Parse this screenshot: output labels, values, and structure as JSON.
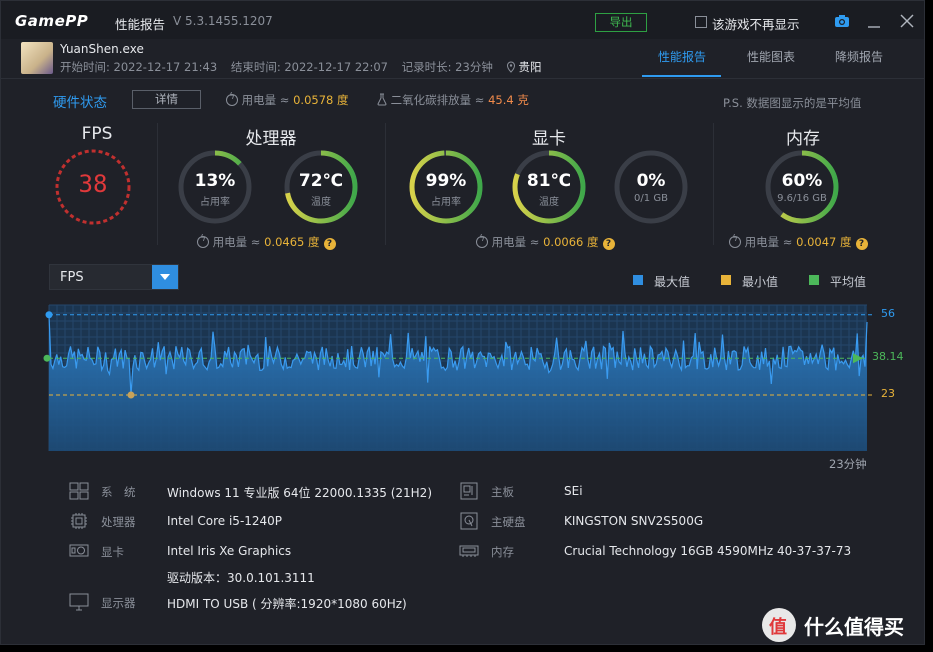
{
  "titlebar": {
    "logo": "GamePP",
    "title": "性能报告",
    "version": "V 5.3.1455.1207",
    "export_label": "导出",
    "no_show_label": "该游戏不再显示"
  },
  "process": {
    "name": "YuanShen.exe",
    "start_time": "开始时间: 2022-12-17 21:43",
    "end_time": "结束时间: 2022-12-17 22:07",
    "duration": "记录时长: 23分钟",
    "location": "贵阳"
  },
  "tabs": [
    {
      "label": "性能报告",
      "active": true
    },
    {
      "label": "性能图表",
      "active": false
    },
    {
      "label": "降频报告",
      "active": false
    }
  ],
  "hardware": {
    "title": "硬件状态",
    "detail_btn": "详情",
    "power_label": "用电量 ≈",
    "power_value": "0.0578 度",
    "co2_label": "二氧化碳排放量 ≈",
    "co2_value": "45.4 克",
    "note": "P.S. 数据图显示的是平均值"
  },
  "sections": {
    "fps": {
      "title": "FPS",
      "value": "38"
    },
    "cpu": {
      "title": "处理器",
      "usage": {
        "value": "13%",
        "label": "占用率",
        "fraction": 0.13
      },
      "temp": {
        "value": "72℃",
        "label": "温度",
        "fraction": 0.72
      },
      "power_label": "用电量 ≈",
      "power_value": "0.0465 度"
    },
    "gpu": {
      "title": "显卡",
      "usage": {
        "value": "99%",
        "label": "占用率",
        "fraction": 0.99
      },
      "temp": {
        "value": "81℃",
        "label": "温度",
        "fraction": 0.81
      },
      "vram": {
        "value": "0%",
        "label": "0/1 GB",
        "fraction": 0.0
      },
      "power_label": "用电量 ≈",
      "power_value": "0.0066 度"
    },
    "mem": {
      "title": "内存",
      "usage": {
        "value": "60%",
        "label": "9.6/16 GB",
        "fraction": 0.6
      },
      "power_label": "用电量 ≈",
      "power_value": "0.0047 度"
    }
  },
  "chart_controls": {
    "metric": "FPS",
    "legend": [
      {
        "label": "最大值",
        "color": "#2f8ee0"
      },
      {
        "label": "最小值",
        "color": "#e8b339"
      },
      {
        "label": "平均值",
        "color": "#4cb85a"
      }
    ]
  },
  "chart_data": {
    "type": "area",
    "series_label": "FPS",
    "max": 56,
    "min": 23,
    "avg": 38.14,
    "ylim": [
      0,
      60
    ],
    "x_end_label": "23分钟",
    "max_label": "56",
    "min_label": "23",
    "avg_label": "38.14"
  },
  "specs": {
    "os_key": "系　统",
    "os_val": "Windows 11 专业版 64位 22000.1335 (21H2)",
    "cpu_key": "处理器",
    "cpu_val": "Intel Core i5-1240P",
    "gpu_key": "显卡",
    "gpu_val": "Intel Iris Xe Graphics",
    "driver_val": "驱动版本：30.0.101.3111",
    "display_key": "显示器",
    "display_val": "HDMI TO USB ( 分辨率:1920*1080 60Hz)",
    "mb_key": "主板",
    "mb_val": "SEi",
    "disk_key": "主硬盘",
    "disk_val": "KINGSTON SNV2S500G",
    "ram_key": "内存",
    "ram_val": "Crucial Technology 16GB 4590MHz 40-37-37-73"
  },
  "watermark": "什么值得买"
}
